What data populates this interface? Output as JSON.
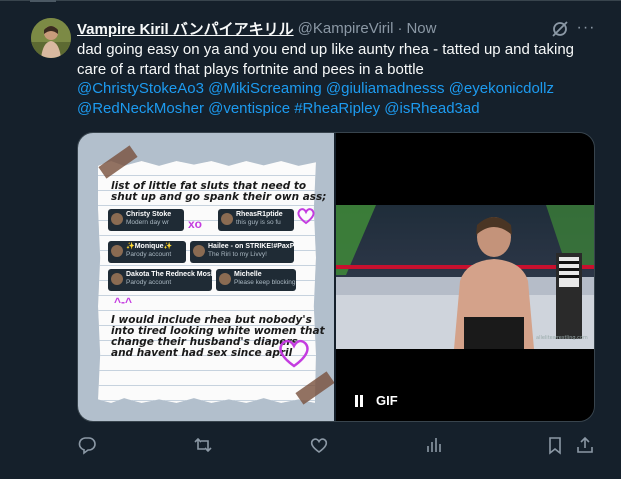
{
  "post": {
    "display_name": "Vampire Kiril バンパイアキリル",
    "handle": "@KampireViril",
    "separator": "·",
    "time": "Now",
    "more_glyph": "···",
    "text_line1": "dad going easy on ya and you end up like aunty rhea - tatted up and taking",
    "text_line2": "care of a rtard that plays fortnite and pees in a bottle",
    "mentions_line1": [
      "@ChristyStokeAo3",
      "@MikiScreaming",
      "@giuliamadnesss",
      "@eyekonicdollz"
    ],
    "mentions_line2": [
      "@RedNeckMosher",
      "@ventispice",
      "#RheaRipley",
      "@isRhead3ad"
    ]
  },
  "media": {
    "note_image": {
      "line1": "list of little fat sluts that need to",
      "line2": "shut up and go spank their own ass;",
      "line3": "I would include rhea but nobody's",
      "line4": "into tired looking white women that",
      "line5": "change their husband's diapers",
      "line6": "and havent had sex since april",
      "cards": [
        {
          "name": "Christy Stoke",
          "sub": "Modern day wr"
        },
        {
          "name": "RheasR1ptide",
          "sub": "this guy is so fu"
        },
        {
          "name": "✨Monique✨",
          "sub": "Parody account"
        },
        {
          "name": "Hailee - on STRIKE!#PaxPack",
          "sub": "The Riri to my Livvy!"
        },
        {
          "name": "Dakota The Redneck Mosher",
          "sub": "Parody account"
        },
        {
          "name": "Michelle",
          "sub": "Please keep blocking"
        }
      ],
      "scribble_xo": "xo",
      "scribble_smile": "^-^"
    },
    "gif_label": "GIF"
  },
  "colors": {
    "background": "#15202b",
    "text": "#f7f9f9",
    "muted": "#8b98a5",
    "link": "#1d9bf0",
    "border": "#38444d"
  },
  "icons": [
    "grok-icon",
    "more-icon",
    "reply-icon",
    "repost-icon",
    "like-icon",
    "views-icon",
    "bookmark-icon",
    "share-icon",
    "pause-icon"
  ]
}
